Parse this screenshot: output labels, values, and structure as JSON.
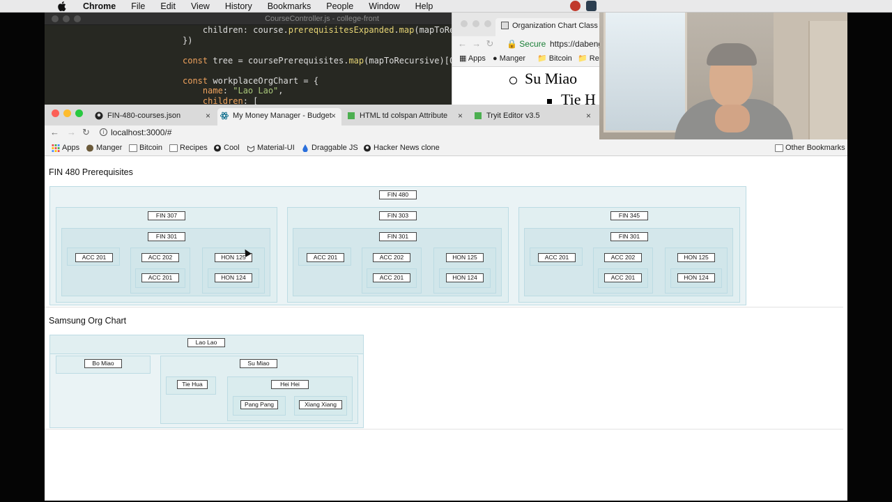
{
  "menubar": {
    "app": "Chrome",
    "items": [
      "File",
      "Edit",
      "View",
      "History",
      "Bookmarks",
      "People",
      "Window",
      "Help"
    ]
  },
  "editor": {
    "title": "CourseController.js - college-front",
    "lines": [
      "    children: course.prerequisitesExpanded.map(mapToRe",
      "})",
      "",
      "const tree = coursePrerequisites.map(mapToRecursive)[0",
      "",
      "const workplaceOrgChart = {",
      "    name: \"Lao Lao\",",
      "    children: ["
    ]
  },
  "side_window": {
    "tab_title": "Organization Chart Class",
    "secure_label": "Secure",
    "url": "https://dabeng",
    "bookmarks": [
      "Apps",
      "Manger",
      "Bitcoin",
      "Rec"
    ],
    "list_item_1": "Su Miao",
    "list_item_2": "Tie H"
  },
  "browser": {
    "tabs": [
      {
        "title": "FIN-480-courses.json",
        "active": false
      },
      {
        "title": "My Money Manager - Budget",
        "active": true
      },
      {
        "title": "HTML td colspan Attribute",
        "active": false
      },
      {
        "title": "Tryit Editor v3.5",
        "active": false
      }
    ],
    "url": "localhost:3000/#",
    "bookmarks": [
      "Apps",
      "Manger",
      "Bitcoin",
      "Recipes",
      "Cool",
      "Material-UI",
      "Draggable JS",
      "Hacker News clone"
    ],
    "other_bookmarks": "Other Bookmarks"
  },
  "page": {
    "section1_title": "FIN 480 Prerequisites",
    "section2_title": "Samsung Org Chart",
    "fin480_tree": {
      "name": "FIN 480",
      "children": [
        {
          "name": "FIN 307",
          "children": [
            {
              "name": "FIN 301",
              "children": [
                {
                  "name": "ACC 201"
                },
                {
                  "name": "ACC 202",
                  "children": [
                    {
                      "name": "ACC 201"
                    }
                  ]
                },
                {
                  "name": "HON 125",
                  "children": [
                    {
                      "name": "HON 124"
                    }
                  ]
                }
              ]
            }
          ]
        },
        {
          "name": "FIN 303",
          "children": [
            {
              "name": "FIN 301",
              "children": [
                {
                  "name": "ACC 201"
                },
                {
                  "name": "ACC 202",
                  "children": [
                    {
                      "name": "ACC 201"
                    }
                  ]
                },
                {
                  "name": "HON 125",
                  "children": [
                    {
                      "name": "HON 124"
                    }
                  ]
                }
              ]
            }
          ]
        },
        {
          "name": "FIN 345",
          "children": [
            {
              "name": "FIN 301",
              "children": [
                {
                  "name": "ACC 201"
                },
                {
                  "name": "ACC 202",
                  "children": [
                    {
                      "name": "ACC 201"
                    }
                  ]
                },
                {
                  "name": "HON 125",
                  "children": [
                    {
                      "name": "HON 124"
                    }
                  ]
                }
              ]
            }
          ]
        }
      ]
    },
    "org_tree": {
      "name": "Lao Lao",
      "children": [
        {
          "name": "Bo Miao"
        },
        {
          "name": "Su Miao",
          "children": [
            {
              "name": "Tie Hua"
            },
            {
              "name": "Hei Hei",
              "children": [
                {
                  "name": "Pang Pang"
                },
                {
                  "name": "Xiang Xiang"
                }
              ]
            }
          ]
        }
      ]
    }
  },
  "colors": {
    "accent_border": "#bcdbe3",
    "traffic_red": "#fc5f57",
    "traffic_yellow": "#fdbc2e",
    "traffic_green": "#28c840"
  }
}
